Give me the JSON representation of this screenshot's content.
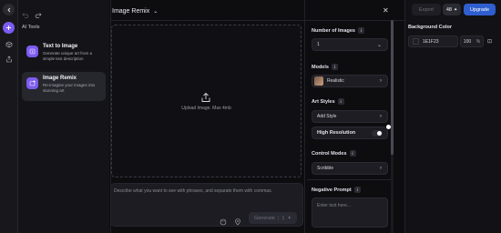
{
  "rail": {
    "icons": [
      "back-icon",
      "plus-icon",
      "cube-icon",
      "share-icon"
    ]
  },
  "header": {
    "title": "Image Remix",
    "export_label": "Export",
    "credits": "48",
    "upgrade_label": "Upgrade"
  },
  "tools": {
    "section_title": "AI Tools",
    "items": [
      {
        "name": "Text to Image",
        "description": "Generate unique art from a simple text description",
        "icon": "text-image-icon"
      },
      {
        "name": "Image Remix",
        "description": "Re-imagine your images into stunning art",
        "icon": "remix-icon"
      }
    ]
  },
  "canvas": {
    "upload_label": "Upload Image. Max 4mb"
  },
  "prompt": {
    "placeholder": "Describe what you want to see with phrases, and separate them with commas.",
    "generate_label": "Generate",
    "generate_cost": "1"
  },
  "settings": {
    "number_of_images_label": "Number of Images",
    "number_of_images_value": "1",
    "models_label": "Models",
    "model_value": "Realistic",
    "art_styles_label": "Art Styles",
    "add_style_label": "Add Style",
    "high_resolution_label": "High Resolution",
    "control_modes_label": "Control Modes",
    "control_mode_value": "Scribble",
    "negative_prompt_label": "Negative Prompt",
    "negative_prompt_placeholder": "Enter text here..."
  },
  "background": {
    "label": "Background Color",
    "hex": "1E1F23",
    "opacity": "100",
    "opacity_unit": "%",
    "swatch_color": "#1E1F23"
  },
  "colors": {
    "accent": "#7c5cf0",
    "upgrade": "#2f5fcf"
  }
}
